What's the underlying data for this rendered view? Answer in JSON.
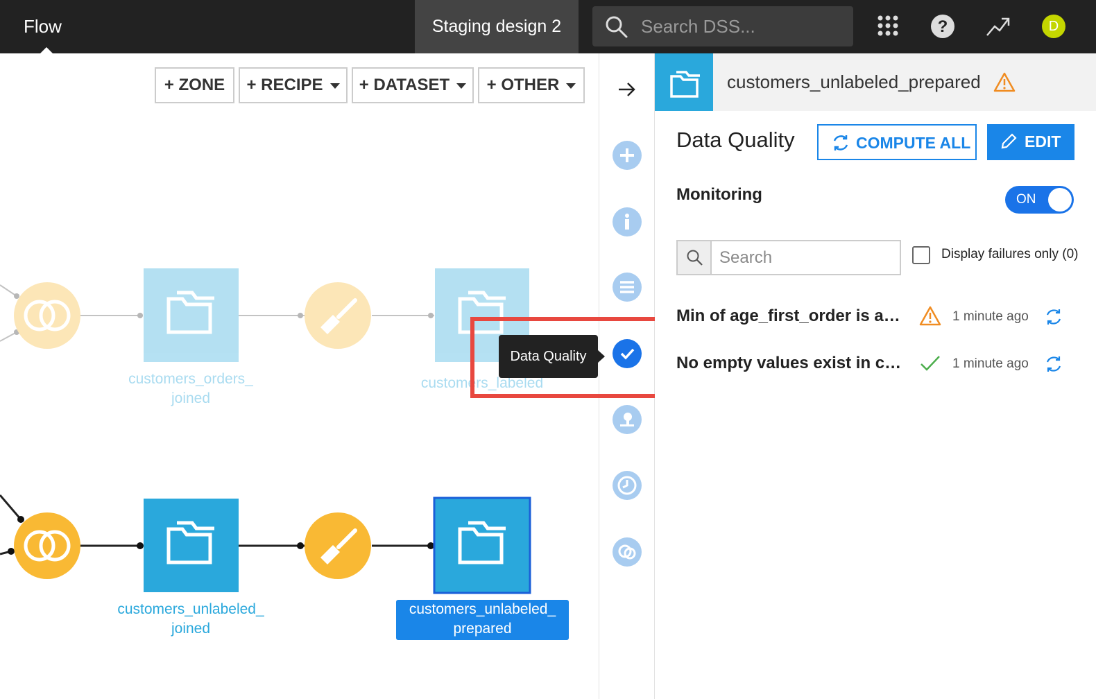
{
  "topbar": {
    "flow_label": "Flow",
    "project_name": "Staging design 2",
    "search_placeholder": "Search DSS...",
    "user_initial": "D"
  },
  "toolbar": {
    "zone": "+ ZONE",
    "recipe": "+ RECIPE",
    "dataset": "+ DATASET",
    "other": "+ OTHER"
  },
  "flow": {
    "datasets": [
      {
        "label_line1": "customers_orders_",
        "label_line2": "joined"
      },
      {
        "label_line1": "customers_labeled",
        "label_line2": ""
      },
      {
        "label_line1": "customers_unlabeled_",
        "label_line2": "joined"
      },
      {
        "label_line1": "customers_unlabeled_",
        "label_line2": "prepared"
      }
    ]
  },
  "tooltip": "Data Quality",
  "panel": {
    "dataset_name": "customers_unlabeled_prepared",
    "section_title": "Data Quality",
    "compute_all": "COMPUTE ALL",
    "edit": "EDIT",
    "monitoring_label": "Monitoring",
    "monitoring_state": "ON",
    "search_placeholder": "Search",
    "failures_only_label": "Display failures only (0)",
    "rules": [
      {
        "name": "Min of age_first_order is above…",
        "status": "warning",
        "time": "1 minute ago"
      },
      {
        "name": "No empty values exist in customer…",
        "status": "ok",
        "time": "1 minute ago"
      }
    ]
  },
  "colors": {
    "topbar": "#222222",
    "accent_blue": "#1a86e8",
    "dataset_blue": "#2aa8dc",
    "recipe_yellow": "#f9b934",
    "warning_orange": "#f08c21",
    "ok_green": "#4cae4c",
    "highlight_red": "#e8483f"
  }
}
